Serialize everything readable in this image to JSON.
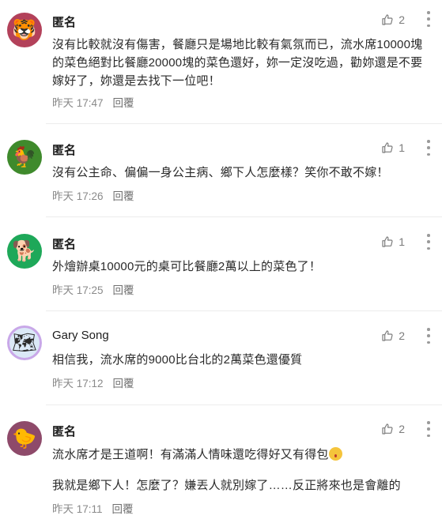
{
  "comments": [
    {
      "name": "匿名",
      "avatar_icon": "tiger-icon",
      "avatar_bg": "#b3415a",
      "avatar_glyph": "🐯",
      "text": "沒有比較就沒有傷害，餐廳只是場地比較有氣氛而已，流水席10000塊的菜色絕對比餐廳20000塊的菜色還好，妳一定沒吃過，勸妳還是不要嫁好了，妳還是去找下一位吧！",
      "time": "昨天 17:47",
      "reply": "回覆",
      "likes": "2"
    },
    {
      "name": "匿名",
      "avatar_icon": "rooster-icon",
      "avatar_bg": "#3f8a2c",
      "avatar_glyph": "🐓",
      "text": "沒有公主命、偏偏一身公主病、鄉下人怎麼樣？笑你不敢不嫁！",
      "time": "昨天 17:26",
      "reply": "回覆",
      "likes": "1"
    },
    {
      "name": "匿名",
      "avatar_icon": "dog-icon",
      "avatar_bg": "#1ea859",
      "avatar_glyph": "🐕",
      "text": "外燴辦桌10000元的桌可比餐廳2萬以上的菜色了！",
      "time": "昨天 17:25",
      "reply": "回覆",
      "likes": "1"
    },
    {
      "name": "Gary Song",
      "avatar_icon": "taiwan-map-icon",
      "avatar_bg": "#dbe9f7",
      "avatar_glyph": "🗺",
      "text": "相信我，流水席的9000比台北的2萬菜色還優質",
      "time": "昨天 17:12",
      "reply": "回覆",
      "likes": "2"
    },
    {
      "name": "匿名",
      "avatar_icon": "chick-icon",
      "avatar_bg": "#8e4a6a",
      "avatar_glyph": "🐤",
      "text": "流水席才是王道啊！有滿滿人情味還吃得好又有得包",
      "text2": "我就是鄉下人！怎麼了？嫌丟人就別嫁了……反正將來也是會離的",
      "time": "昨天 17:11",
      "reply": "回覆",
      "likes": "2"
    }
  ]
}
